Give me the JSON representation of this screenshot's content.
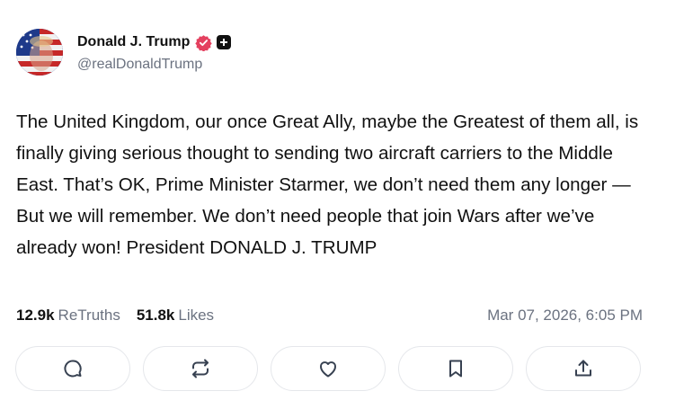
{
  "author": {
    "display_name": "Donald J. Trump",
    "handle": "@realDonaldTrump",
    "avatar_icon": "avatar-flag-portrait",
    "verified_icon": "verified-badge-icon",
    "verified_color": "#e4405f",
    "plus_icon": "plus-badge-icon"
  },
  "post": {
    "text": "The United Kingdom, our once Great Ally, maybe the Greatest of them all, is finally giving serious thought to sending two aircraft carriers to the Middle East. That’s OK, Prime Minister Starmer, we don’t need them any longer — But we will remember. We don’t need people that join Wars after we’ve already won! President DONALD J. TRUMP"
  },
  "stats": {
    "retruths_count": "12.9k",
    "retruths_label": "ReTruths",
    "likes_count": "51.8k",
    "likes_label": "Likes",
    "timestamp": "Mar 07, 2026, 6:05 PM"
  },
  "actions": [
    {
      "icon": "reply-icon"
    },
    {
      "icon": "retruth-icon"
    },
    {
      "icon": "like-icon"
    },
    {
      "icon": "bookmark-icon"
    },
    {
      "icon": "share-icon"
    }
  ],
  "colors": {
    "text": "#111111",
    "muted": "#6b7280",
    "border": "#e5e7eb"
  }
}
